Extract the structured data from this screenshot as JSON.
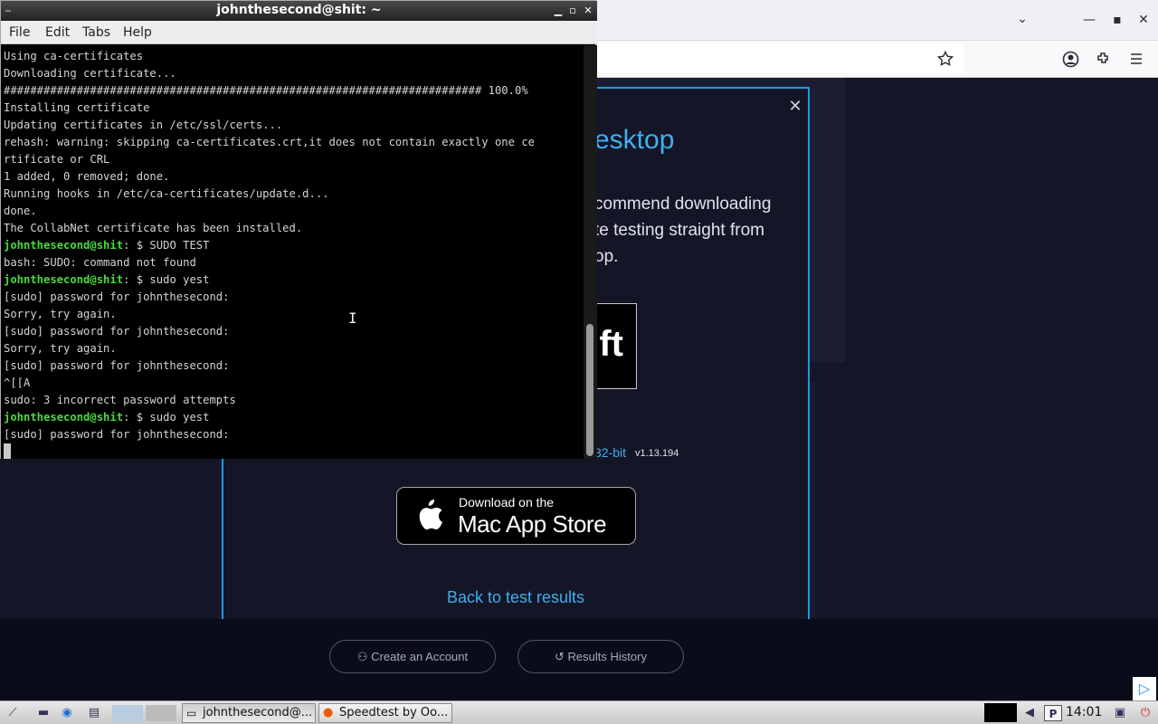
{
  "firefox": {
    "minimize_glyph": "—",
    "maximize_glyph": "▪",
    "close_glyph": "✕",
    "dropdown_glyph": "⌄",
    "page": {
      "modal_title": "esktop",
      "modal_text_lines": [
        "commend downloading",
        "te testing straight from",
        "op."
      ],
      "ms_fragment": "ft",
      "linux_link": "32-bit",
      "linux_version": "v1.13.194",
      "appstore_line1": "Download on the",
      "appstore_line2": "Mac App Store",
      "back_link": "Back to test results",
      "create_account": "Create an Account",
      "results_history": "Results History",
      "close_glyph": "✕"
    }
  },
  "terminal": {
    "title": "johnthesecond@shit: ~",
    "menu": [
      "File",
      "Edit",
      "Tabs",
      "Help"
    ],
    "prompt_user": "johnthesecond@shit",
    "lines": [
      {
        "text": "Using ca-certificates"
      },
      {
        "text": "Downloading certificate..."
      },
      {
        "text": "######################################################################## 100.0%"
      },
      {
        "text": "Installing certificate"
      },
      {
        "text": "Updating certificates in /etc/ssl/certs..."
      },
      {
        "text": "rehash: warning: skipping ca-certificates.crt,it does not contain exactly one ce"
      },
      {
        "text": "rtificate or CRL"
      },
      {
        "text": "1 added, 0 removed; done."
      },
      {
        "text": "Running hooks in /etc/ca-certificates/update.d..."
      },
      {
        "text": "done."
      },
      {
        "text": "The CollabNet certificate has been installed."
      },
      {
        "prompt": "johnthesecond@shit",
        "text": ": $ SUDO TEST"
      },
      {
        "text": "bash: SUDO: command not found"
      },
      {
        "prompt": "johnthesecond@shit",
        "text": ": $ sudo yest"
      },
      {
        "text": "[sudo] password for johnthesecond:"
      },
      {
        "text": "Sorry, try again."
      },
      {
        "text": "[sudo] password for johnthesecond:"
      },
      {
        "text": "Sorry, try again."
      },
      {
        "text": "[sudo] password for johnthesecond:"
      },
      {
        "text": "^[[A"
      },
      {
        "text": "sudo: 3 incorrect password attempts"
      },
      {
        "prompt": "johnthesecond@shit",
        "text": ": $ sudo yest"
      },
      {
        "text": "[sudo] password for johnthesecond:"
      }
    ]
  },
  "taskbar": {
    "tasks": [
      {
        "label": "johnthesecond@..."
      },
      {
        "label": "Speedtest by Oo..."
      }
    ],
    "clock": "14:01"
  }
}
